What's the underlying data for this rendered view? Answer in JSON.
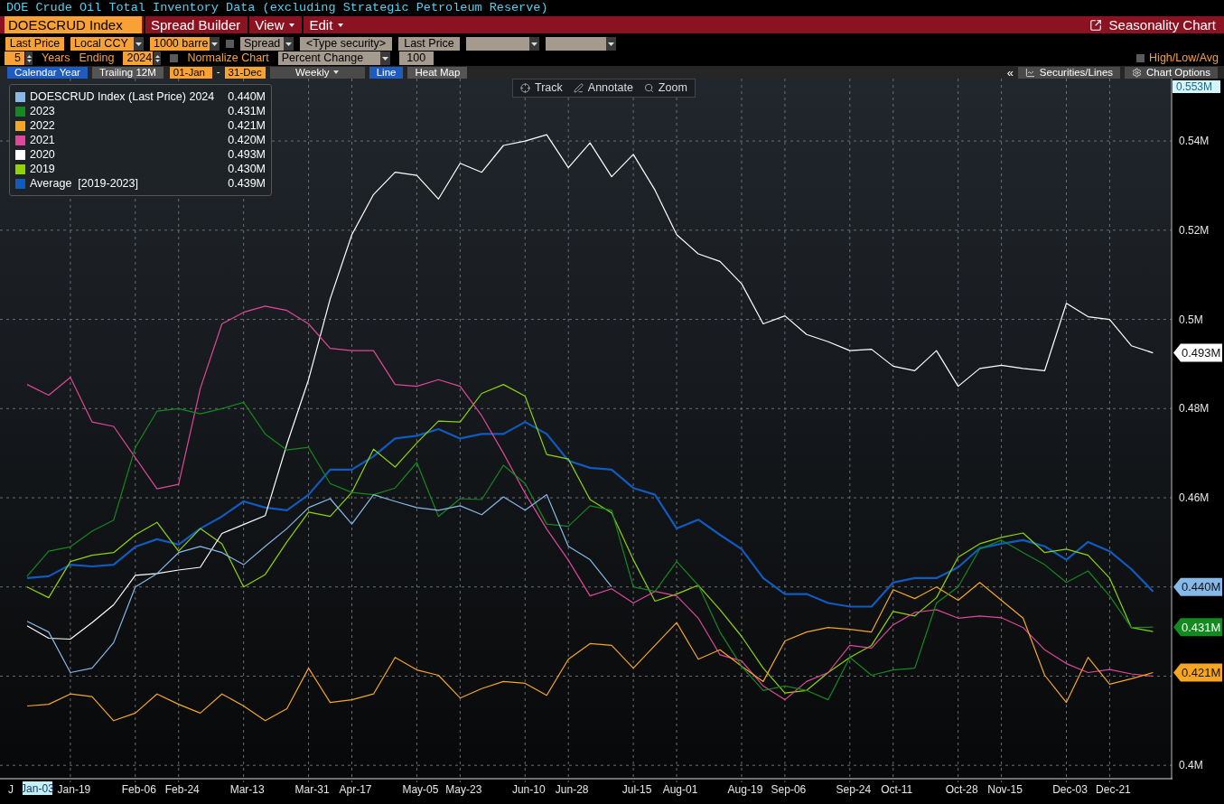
{
  "title": "DOE Crude Oil Total Inventory Data (excluding Strategic Petroleum Reserve)",
  "toolbar": {
    "security": "DOESCRUD Index",
    "menus": [
      {
        "label": "Spread Builder",
        "dropdown": false
      },
      {
        "label": "View",
        "dropdown": true
      },
      {
        "label": "Edit",
        "dropdown": true
      }
    ],
    "app_title": "Seasonality Chart"
  },
  "settings_row_1": [
    {
      "kind": "field",
      "value": "Last Price",
      "disabled": false
    },
    {
      "kind": "select",
      "value": "Local CCY",
      "disabled": false
    },
    {
      "kind": "select",
      "value": "1000 barre",
      "disabled": false
    },
    {
      "kind": "checkbox",
      "checked": false
    },
    {
      "kind": "select",
      "value": "Spread",
      "disabled": true
    },
    {
      "kind": "field",
      "value": "<Type security>",
      "disabled": true
    },
    {
      "kind": "field",
      "value": "Last Price",
      "disabled": true
    },
    {
      "kind": "select",
      "disabled": true
    },
    {
      "kind": "select",
      "disabled": true
    }
  ],
  "settings_row_2": [
    {
      "kind": "stepper",
      "value": "5"
    },
    {
      "kind": "label",
      "text": "Years"
    },
    {
      "kind": "label",
      "text": "Ending"
    },
    {
      "kind": "stepper",
      "value": "2024"
    },
    {
      "kind": "checkbox",
      "checked": false
    },
    {
      "kind": "label",
      "text": "Normalize Chart"
    },
    {
      "kind": "select",
      "value": "Percent Change",
      "disabled": true
    },
    {
      "kind": "field",
      "value": "100",
      "disabled": true
    }
  ],
  "high_low_avg": {
    "label": "High/Low/Avg",
    "checked": false
  },
  "range_tabs": [
    {
      "label": "Calendar Year",
      "selected": true
    },
    {
      "label": "Trailing 12M",
      "selected": false
    }
  ],
  "date_from": "01-Jan",
  "date_separator": "-",
  "date_to": "31-Dec",
  "frequency": "Weekly",
  "chart_type_tabs": [
    {
      "label": "Line",
      "selected": true
    },
    {
      "label": "Heat Map",
      "selected": false
    }
  ],
  "collapse": "«",
  "panel_buttons": [
    {
      "kind": "securities",
      "label": "Securities/Lines"
    },
    {
      "kind": "options",
      "label": "Chart Options"
    }
  ],
  "chart_tools": [
    {
      "kind": "track",
      "label": "Track"
    },
    {
      "kind": "annotate",
      "label": "Annotate"
    },
    {
      "kind": "zoom",
      "label": "Zoom"
    }
  ],
  "chart": {
    "axis_max_label": "0.553M",
    "x_cursor": {
      "label": "Jan-03",
      "clipped_label": "J"
    },
    "legend_values": [
      "0.440M",
      "0.431M",
      "0.421M",
      "0.420M",
      "0.493M",
      "0.430M",
      "0.439M"
    ],
    "end_tags": [
      {
        "label": "0.493M",
        "color": "#ffffff"
      },
      {
        "label": "0.440M",
        "color": "#86b9e8"
      },
      {
        "label": "0.431M",
        "color": "#14891f"
      },
      {
        "label": "0.421M",
        "color": "#f5a623"
      }
    ],
    "chart_data": {
      "type": "line",
      "grid": true,
      "ylim": [
        0.397,
        0.554
      ],
      "categories": [
        null,
        null,
        "Jan-19",
        null,
        null,
        "Feb-06",
        null,
        "Feb-24",
        null,
        null,
        "Mar-13",
        null,
        null,
        "Mar-31",
        null,
        "Apr-17",
        null,
        null,
        "May-05",
        null,
        "May-23",
        null,
        null,
        "Jun-10",
        null,
        "Jun-28",
        null,
        null,
        "Jul-15",
        null,
        "Aug-01",
        null,
        null,
        "Aug-19",
        null,
        "Sep-06",
        null,
        null,
        "Sep-24",
        null,
        "Oct-11",
        null,
        null,
        "Oct-28",
        null,
        "Nov-15",
        null,
        null,
        "Dec-03",
        null,
        "Dec-21",
        null,
        null
      ],
      "yticks": [
        {
          "value": 0.4,
          "label": "0.4M"
        },
        {
          "value": 0.46,
          "label": "0.46M"
        },
        {
          "value": 0.48,
          "label": "0.48M"
        },
        {
          "value": 0.5,
          "label": "0.5M"
        },
        {
          "value": 0.52,
          "label": "0.52M"
        },
        {
          "value": 0.54,
          "label": "0.54M"
        }
      ],
      "series": [
        {
          "name": "DOESCRUD Index (Last Price) 2024",
          "color": "#86b9e8",
          "values": [
            0.4323,
            0.4299,
            0.4208,
            0.4218,
            0.4275,
            0.44,
            0.443,
            0.4477,
            0.4491,
            0.4477,
            0.445,
            0.4491,
            0.4531,
            0.4578,
            0.4598,
            0.4541,
            0.4607,
            0.4592,
            0.4578,
            0.4572,
            0.4582,
            0.4562,
            0.4602,
            0.4572,
            0.4607,
            0.4491,
            0.4461,
            0.44,
            null,
            null,
            null,
            null,
            null,
            null,
            null,
            null,
            null,
            null,
            null,
            null,
            null,
            null,
            null,
            null,
            null,
            null,
            null,
            null,
            null,
            null,
            null,
            null,
            null
          ]
        },
        {
          "name": "2023",
          "color": "#14891f",
          "values": [
            0.4424,
            0.448,
            0.449,
            0.4525,
            0.455,
            0.4713,
            0.4794,
            0.48,
            0.4788,
            0.48,
            0.4814,
            0.4743,
            0.4707,
            0.4713,
            0.4632,
            0.4612,
            0.4607,
            0.4622,
            0.4679,
            0.4558,
            0.4598,
            0.4596,
            0.4673,
            0.4632,
            0.4541,
            0.4536,
            0.4582,
            0.4572,
            0.44,
            0.439,
            0.4457,
            0.4404,
            0.4299,
            0.4222,
            0.4168,
            0.4178,
            0.4168,
            0.4147,
            0.4242,
            0.4202,
            0.4214,
            0.4218,
            0.4364,
            0.44,
            0.4485,
            0.4505,
            0.4477,
            0.445,
            0.441,
            0.4436,
            0.438,
            0.4309,
            0.431
          ]
        },
        {
          "name": "2022",
          "color": "#f5a623",
          "values": [
            0.4133,
            0.4137,
            0.416,
            0.4154,
            0.41,
            0.4117,
            0.416,
            0.4137,
            0.4117,
            0.416,
            0.4133,
            0.41,
            0.4127,
            0.4218,
            0.4141,
            0.4147,
            0.416,
            0.4242,
            0.4214,
            0.4202,
            0.4151,
            0.4172,
            0.4188,
            0.4184,
            0.4157,
            0.4238,
            0.4273,
            0.4269,
            0.4218,
            0.4269,
            0.432,
            0.4238,
            0.4259,
            0.4222,
            0.4188,
            0.4279,
            0.4299,
            0.4309,
            0.4305,
            0.4299,
            0.4394,
            0.4374,
            0.44,
            0.437,
            0.441,
            0.437,
            0.433,
            0.4202,
            0.4141,
            0.4242,
            0.4182,
            0.4194,
            0.4208
          ]
        },
        {
          "name": "2021",
          "color": "#e0479b",
          "values": [
            0.4854,
            0.483,
            0.487,
            0.477,
            0.476,
            0.469,
            0.462,
            0.463,
            0.4845,
            0.499,
            0.5016,
            0.503,
            0.502,
            0.499,
            0.4935,
            0.493,
            0.493,
            0.4854,
            0.485,
            0.4865,
            0.485,
            0.4784,
            0.47,
            0.461,
            0.453,
            0.446,
            0.438,
            0.4396,
            0.4364,
            0.439,
            0.438,
            0.433,
            0.4248,
            0.4234,
            0.4178,
            0.4147,
            0.4188,
            0.4208,
            0.4269,
            0.4263,
            0.4315,
            0.4343,
            0.4349,
            0.433,
            0.4335,
            0.4331,
            0.4309,
            0.4259,
            0.4228,
            0.4208,
            0.4215,
            0.4205,
            0.42
          ]
        },
        {
          "name": "2020",
          "color": "#ffffff",
          "values": [
            0.4313,
            0.4285,
            0.4283,
            0.432,
            0.436,
            0.4426,
            0.443,
            0.4438,
            0.4444,
            0.452,
            0.454,
            0.456,
            0.472,
            0.4865,
            0.5046,
            0.519,
            0.528,
            0.533,
            0.5323,
            0.527,
            0.535,
            0.533,
            0.539,
            0.54,
            0.5414,
            0.534,
            0.5396,
            0.532,
            0.537,
            0.529,
            0.519,
            0.5147,
            0.513,
            0.508,
            0.499,
            0.5008,
            0.4966,
            0.495,
            0.493,
            0.4933,
            0.4895,
            0.4885,
            0.493,
            0.485,
            0.489,
            0.4897,
            0.489,
            0.4885,
            0.5036,
            0.5006,
            0.5,
            0.4941,
            0.4925
          ]
        },
        {
          "name": "2019",
          "color": "#8fd400",
          "values": [
            0.44,
            0.4376,
            0.4457,
            0.4471,
            0.4477,
            0.4517,
            0.4545,
            0.448,
            0.4531,
            0.4497,
            0.44,
            0.4428,
            0.4501,
            0.4568,
            0.4558,
            0.4612,
            0.4709,
            0.4669,
            0.4723,
            0.4772,
            0.477,
            0.4834,
            0.4854,
            0.4828,
            0.4697,
            0.4687,
            0.4596,
            0.4566,
            0.4461,
            0.4368,
            0.4384,
            0.4404,
            0.4349,
            0.4289,
            0.4218,
            0.4162,
            0.4168,
            0.4208,
            0.4242,
            0.4269,
            0.4345,
            0.4335,
            0.4376,
            0.4467,
            0.4497,
            0.4511,
            0.4521,
            0.4477,
            0.4485,
            0.4471,
            0.442,
            0.4309,
            0.43
          ]
        },
        {
          "name": "Average  [2019-2023]",
          "color": "#0f5bc0",
          "values": [
            0.442,
            0.4424,
            0.445,
            0.4446,
            0.445,
            0.449,
            0.4507,
            0.4495,
            0.4531,
            0.4558,
            0.4592,
            0.4578,
            0.4572,
            0.4607,
            0.4663,
            0.4663,
            0.4693,
            0.4733,
            0.4739,
            0.4754,
            0.4733,
            0.4743,
            0.4743,
            0.477,
            0.4743,
            0.4683,
            0.4667,
            0.4663,
            0.4622,
            0.4607,
            0.4531,
            0.4551,
            0.4517,
            0.4485,
            0.442,
            0.4384,
            0.4384,
            0.4364,
            0.4356,
            0.4356,
            0.441,
            0.442,
            0.442,
            0.4444,
            0.4487,
            0.4497,
            0.4505,
            0.4491,
            0.4461,
            0.4501,
            0.448,
            0.444,
            0.439
          ]
        }
      ]
    }
  }
}
